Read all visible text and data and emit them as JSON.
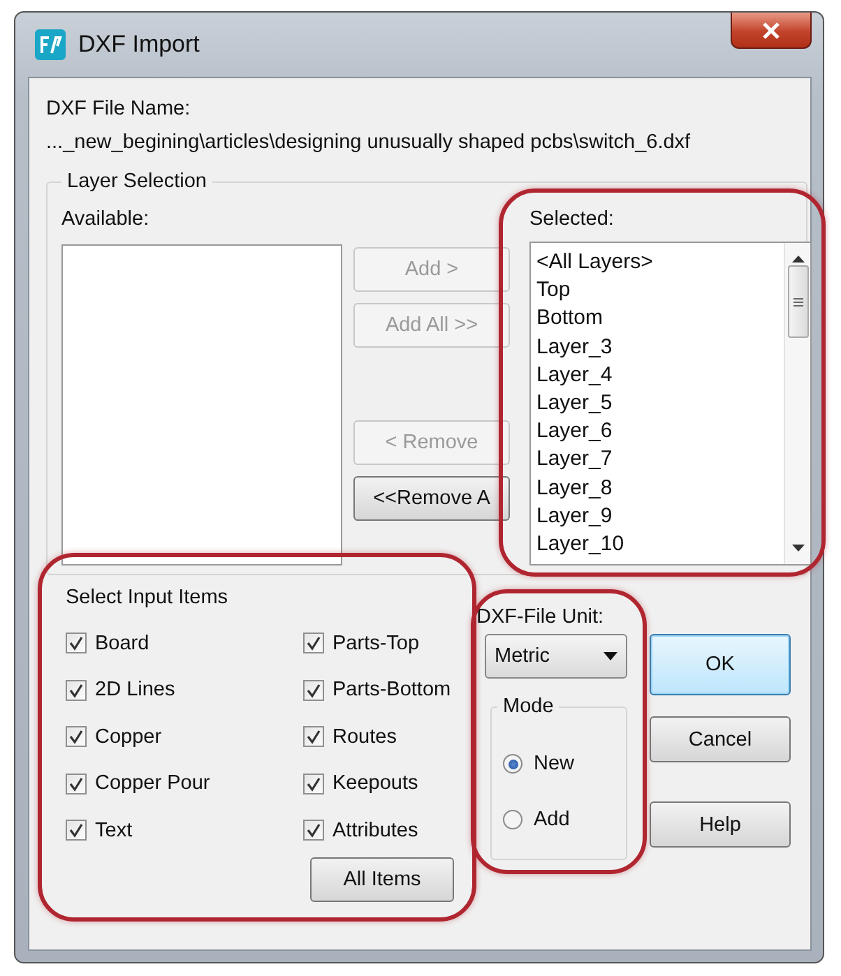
{
  "window": {
    "title": "DXF Import"
  },
  "file_name": {
    "label": "DXF File Name:",
    "value": "..._new_begining\\articles\\designing unusually shaped pcbs\\switch_6.dxf"
  },
  "layer_selection": {
    "title": "Layer Selection",
    "available": {
      "label": "Available:"
    },
    "buttons": [
      {
        "label": "Add >",
        "disabled": true
      },
      {
        "label": "Add All >>",
        "disabled": true
      },
      {
        "label": "< Remove",
        "disabled": true
      },
      {
        "label": "<<Remove A",
        "disabled": false
      }
    ],
    "selected": {
      "label": "Selected:",
      "highlighted": true,
      "items": [
        "<All Layers>",
        "Top",
        "Bottom",
        "Layer_3",
        "Layer_4",
        "Layer_5",
        "Layer_6",
        "Layer_7",
        "Layer_8",
        "Layer_9",
        "Layer_10"
      ]
    }
  },
  "input_items": {
    "title": "Select Input Items",
    "highlighted": true,
    "items": [
      {
        "label": "Board",
        "checked": true
      },
      {
        "label": "2D Lines",
        "checked": true
      },
      {
        "label": "Copper",
        "checked": true
      },
      {
        "label": "Copper Pour",
        "checked": true
      },
      {
        "label": "Text",
        "checked": true
      },
      {
        "label": "Parts-Top",
        "checked": true
      },
      {
        "label": "Parts-Bottom",
        "checked": true
      },
      {
        "label": "Routes",
        "checked": true
      },
      {
        "label": "Keepouts",
        "checked": true
      },
      {
        "label": "Attributes",
        "checked": true
      }
    ],
    "button": "All  Items"
  },
  "options": {
    "highlighted": true,
    "unit": {
      "label": "DXF-File Unit:",
      "value": "Metric"
    },
    "mode": {
      "title": "Mode",
      "options": [
        {
          "label": "New",
          "selected": true
        },
        {
          "label": "Add",
          "selected": false
        }
      ]
    }
  },
  "buttons": [
    {
      "label": "OK",
      "default": true
    },
    {
      "label": "Cancel",
      "default": false
    },
    {
      "label": "Help",
      "default": false
    }
  ]
}
